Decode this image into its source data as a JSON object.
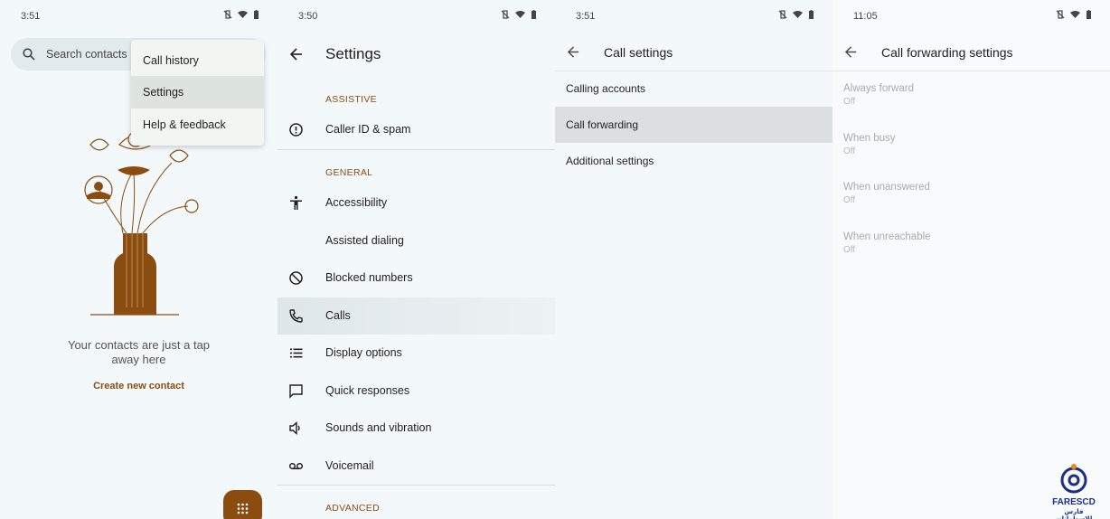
{
  "panels": {
    "contacts": {
      "status_time": "3:51",
      "search_placeholder": "Search contacts",
      "menu": [
        "Call history",
        "Settings",
        "Help & feedback"
      ],
      "empty_message_line1": "Your contacts are just a tap",
      "empty_message_line2": "away here",
      "create_link": "Create new contact",
      "icons": {
        "search": "search-icon",
        "fab": "dialpad-icon"
      },
      "accent_color": "#8a4d0f"
    },
    "settings": {
      "status_time": "3:50",
      "title": "Settings",
      "sections": {
        "assistive": "ASSISTIVE",
        "general": "GENERAL",
        "advanced": "ADVANCED"
      },
      "items": {
        "caller_id": "Caller ID & spam",
        "accessibility": "Accessibility",
        "assisted_dialing": "Assisted dialing",
        "blocked_numbers": "Blocked numbers",
        "calls": "Calls",
        "display_options": "Display options",
        "quick_responses": "Quick responses",
        "sounds_vibration": "Sounds and vibration",
        "voicemail": "Voicemail"
      }
    },
    "call_settings": {
      "status_time": "3:51",
      "title": "Call settings",
      "items": [
        "Calling accounts",
        "Call forwarding",
        "Additional settings"
      ]
    },
    "call_forwarding": {
      "status_time": "11:05",
      "title": "Call forwarding settings",
      "items": [
        {
          "title": "Always forward",
          "value": "Off"
        },
        {
          "title": "When busy",
          "value": "Off"
        },
        {
          "title": "When unanswered",
          "value": "Off"
        },
        {
          "title": "When unreachable",
          "value": "Off"
        }
      ]
    }
  },
  "watermark": {
    "brand": "FARESCD",
    "subtitle": "فارس للاسطوانات"
  }
}
